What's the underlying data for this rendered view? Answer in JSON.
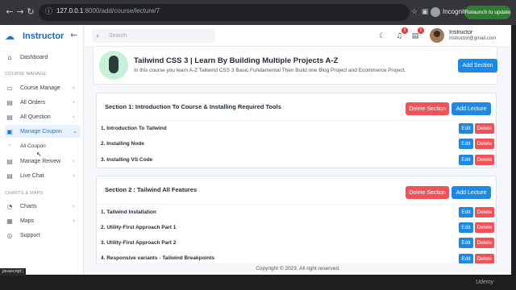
{
  "browser": {
    "url_host": "127.0.0.1",
    "url_rest": ":8000/add/course/lecture/7",
    "incognito_label": "Incognito",
    "relaunch_label": "Relaunch to update"
  },
  "sidebar": {
    "brand": "Instructor",
    "items": [
      {
        "label": "Dashboard",
        "icon": "home-icon"
      },
      {
        "label": "Course Manage",
        "icon": "book-icon",
        "chevron": "‹"
      },
      {
        "label": "All Orders",
        "icon": "orders-icon",
        "chevron": "‹"
      },
      {
        "label": "All Question",
        "icon": "question-icon",
        "chevron": "‹"
      },
      {
        "label": "Manage Coupon",
        "icon": "coupon-icon",
        "chevron": "⌄"
      },
      {
        "label": "All Coupon",
        "icon": "dot"
      },
      {
        "label": "Manage Reivew",
        "icon": "review-icon",
        "chevron": "‹"
      },
      {
        "label": "Live Chat",
        "icon": "chat-icon",
        "chevron": "‹"
      },
      {
        "label": "Charts",
        "icon": "chart-icon",
        "chevron": "‹"
      },
      {
        "label": "Maps",
        "icon": "map-icon",
        "chevron": "‹"
      },
      {
        "label": "Support",
        "icon": "support-icon"
      }
    ],
    "sections": {
      "course_manage": "COURSE MANAGE",
      "charts_maps": "CHARTS & MAPS"
    }
  },
  "topbar": {
    "search_placeholder": "Search",
    "notif_count": "0",
    "cart_count": "0",
    "user_name": "Instructor",
    "user_email": "instructor@gmail.com"
  },
  "course": {
    "title": "Tailwind CSS 3 | Learn By Building Multiple Projects A-Z",
    "description": "In this course you learn A-Z Tailwind CSS 3 Basic Fundamental Then Build one Blog Project and Ecommerce Project.",
    "add_section_label": "Add Section"
  },
  "sections": [
    {
      "title": "Section 1: Introduction To Course & Installing Required Tools",
      "delete_label": "Delete Section",
      "add_label": "Add Lecture",
      "lectures": [
        "1. Introduction To Tailwind",
        "2. Installing Node",
        "3. Installing VS Code"
      ]
    },
    {
      "title": "Section 2 : Tailwind All Features",
      "delete_label": "Delete Section",
      "add_label": "Add Lecture",
      "lectures": [
        "1. Tailwind Installation",
        "2. Utility-First Approach Part 1",
        "3. Utility-First Approach Part 2",
        "4. Responsive variants - Tailwind Breakpoints"
      ]
    }
  ],
  "lecture_actions": {
    "edit": "Edit",
    "delete": "Delete"
  },
  "footer": "Copyright © 2023. All right reserved.",
  "status_bar": "javascript:;",
  "watermark": "Udemy",
  "colors": {
    "primary": "#1e88e5",
    "danger": "#ef5357",
    "brand": "#1565c0"
  }
}
